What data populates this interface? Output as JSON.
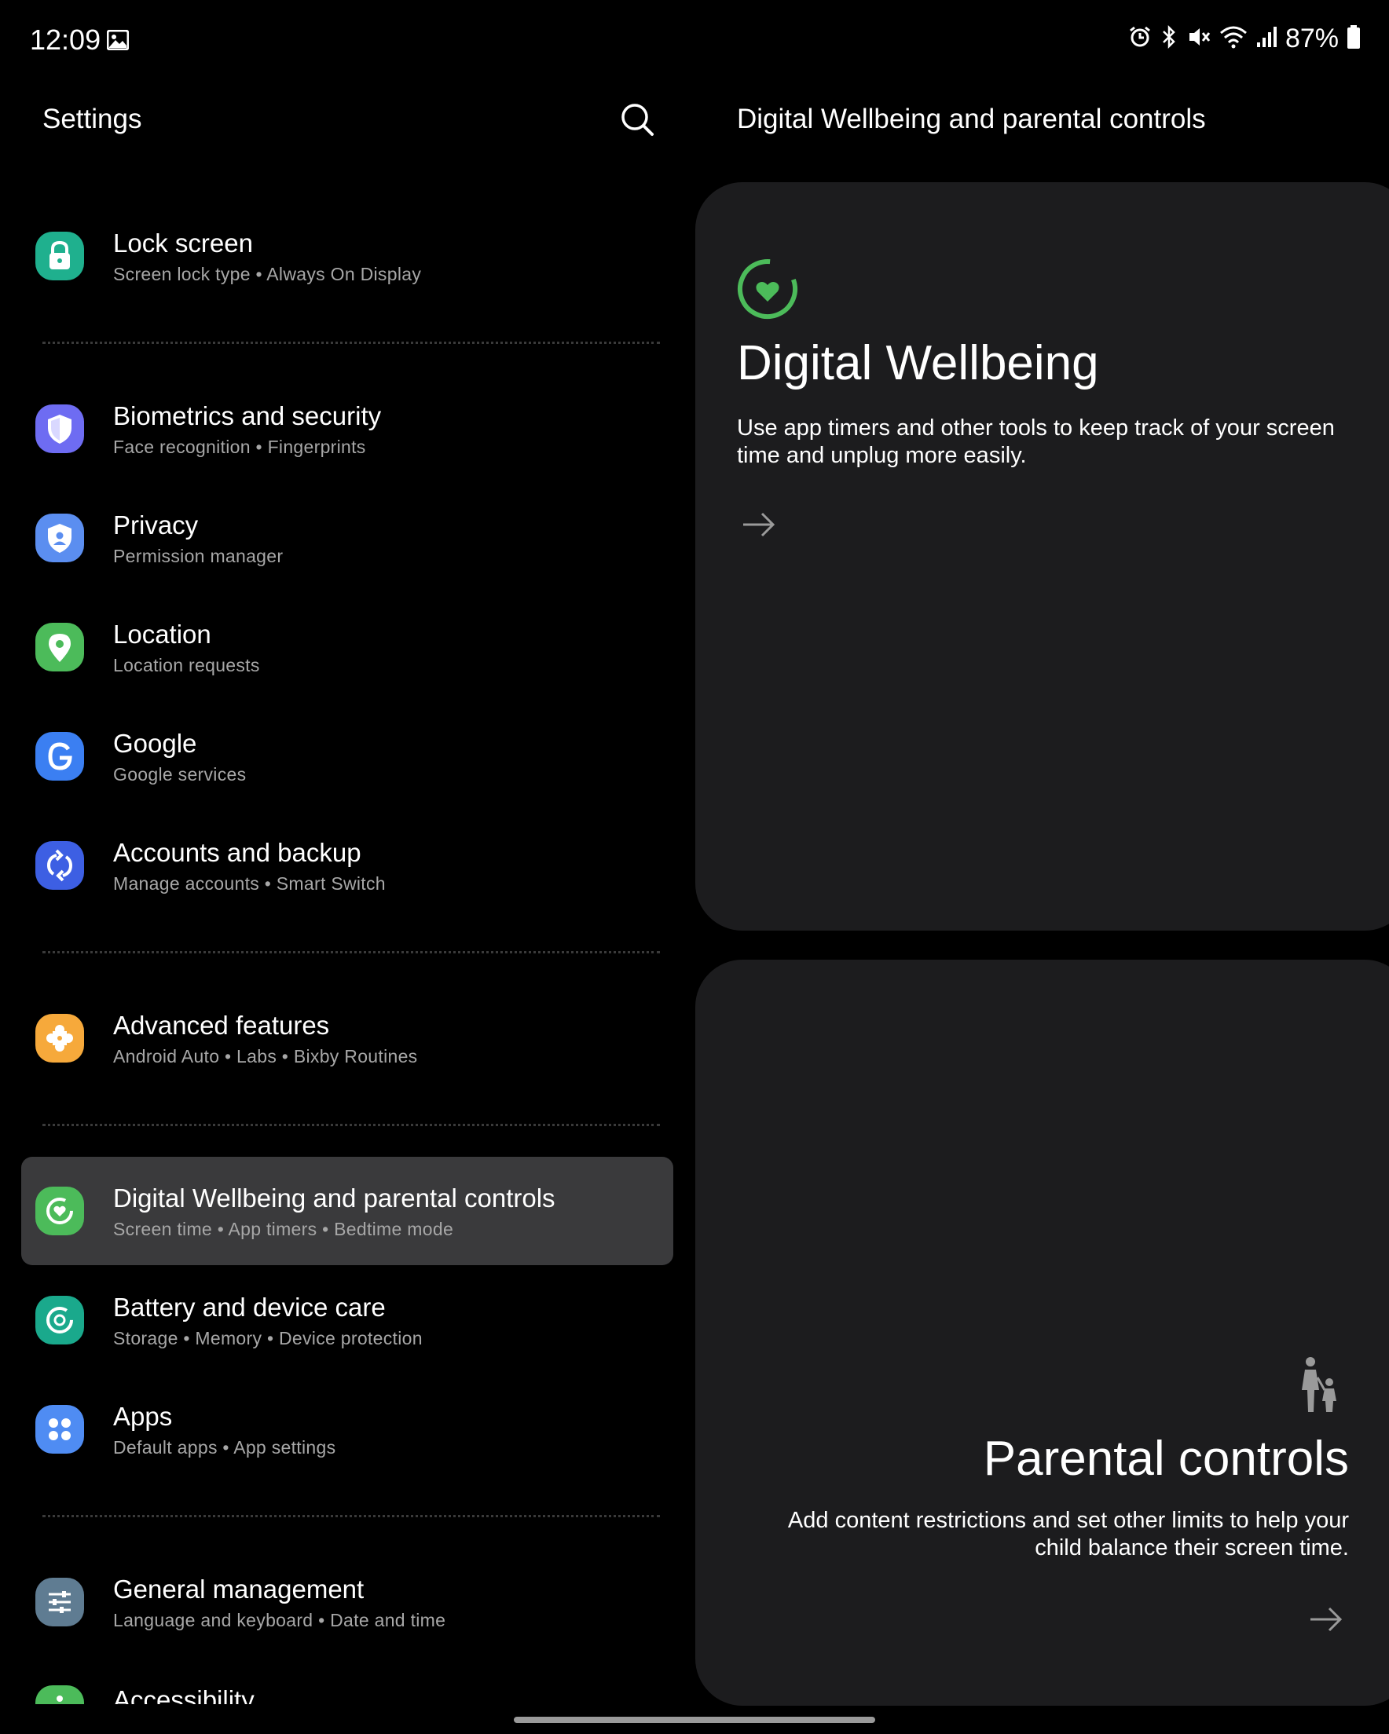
{
  "status_bar": {
    "time": "12:09",
    "battery": "87%",
    "icons": [
      "gallery-icon",
      "alarm-icon",
      "bluetooth-icon",
      "mute-icon",
      "wifi-icon",
      "signal-icon",
      "battery-icon"
    ]
  },
  "left_pane": {
    "title": "Settings",
    "items": [
      {
        "title": "Lock screen",
        "subtitle": "Screen lock type  •  Always On Display",
        "icon": "lock-icon",
        "color": "#1fb08e"
      },
      {
        "title": "Biometrics and security",
        "subtitle": "Face recognition  •  Fingerprints",
        "icon": "shield-icon",
        "color": "#6e6cf2"
      },
      {
        "title": "Privacy",
        "subtitle": "Permission manager",
        "icon": "privacy-icon",
        "color": "#5b8ef0"
      },
      {
        "title": "Location",
        "subtitle": "Location requests",
        "icon": "location-pin-icon",
        "color": "#4cbb5a"
      },
      {
        "title": "Google",
        "subtitle": "Google services",
        "icon": "google-icon",
        "color": "#3b7ff2"
      },
      {
        "title": "Accounts and backup",
        "subtitle": "Manage accounts  •  Smart Switch",
        "icon": "sync-icon",
        "color": "#3d5fe3"
      },
      {
        "title": "Advanced features",
        "subtitle": "Android Auto  •  Labs  •  Bixby Routines",
        "icon": "puzzle-icon",
        "color": "#f6a93b"
      },
      {
        "title": "Digital Wellbeing and parental controls",
        "subtitle": "Screen time  •  App timers  •  Bedtime mode",
        "icon": "wellbeing-icon",
        "color": "#4cbb5a"
      },
      {
        "title": "Battery and device care",
        "subtitle": "Storage  •  Memory  •  Device protection",
        "icon": "device-care-icon",
        "color": "#1aa98c"
      },
      {
        "title": "Apps",
        "subtitle": "Default apps  •  App settings",
        "icon": "apps-grid-icon",
        "color": "#4f8cf3"
      },
      {
        "title": "General management",
        "subtitle": "Language and keyboard  •  Date and time",
        "icon": "sliders-icon",
        "color": "#5f7c92"
      },
      {
        "title": "Accessibility",
        "subtitle": "",
        "icon": "accessibility-icon",
        "color": "#4cbb5a"
      }
    ]
  },
  "right_pane": {
    "title": "Digital Wellbeing and parental controls",
    "digital_wellbeing": {
      "title": "Digital Wellbeing",
      "description": "Use app timers and other tools to keep track of your screen time and unplug more easily."
    },
    "parental_controls": {
      "title": "Parental controls",
      "description": "Add content restrictions and set other limits to help your child balance their screen time."
    }
  },
  "colors": {
    "background": "#000000",
    "card": "#1c1c1e",
    "selected_item": "#3a3a3c",
    "accent_green": "#4cbb5a"
  }
}
